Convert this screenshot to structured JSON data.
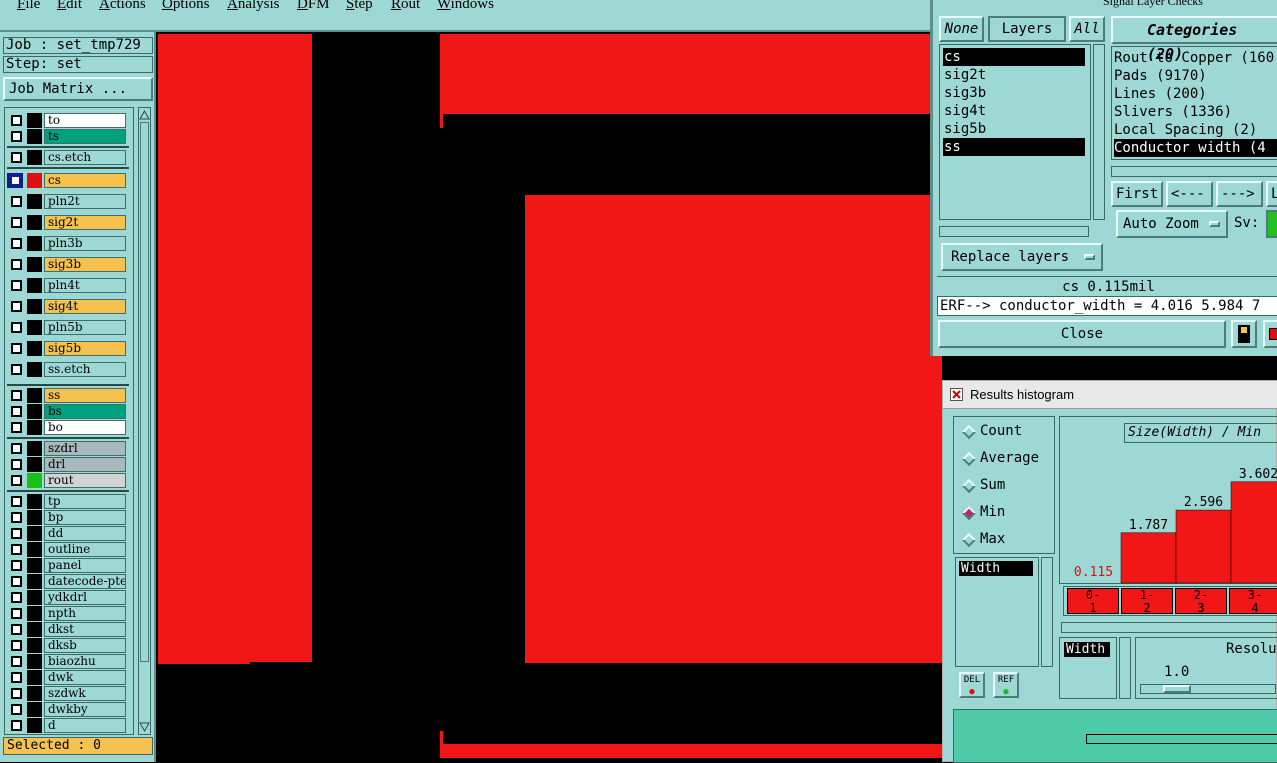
{
  "menu": [
    "File",
    "Edit",
    "Actions",
    "Options",
    "Analysis",
    "DFM",
    "Step",
    "Rout",
    "Windows"
  ],
  "job": {
    "label": "Job : set_tmp729",
    "step": "Step: set",
    "matrix_button": "Job Matrix ..."
  },
  "layers": [
    {
      "name": "to",
      "bg": "#ffffff",
      "swatch": "#000000"
    },
    {
      "name": "ts",
      "bg": "#00a17e",
      "swatch": "#000000"
    },
    {
      "name": "cs.etch",
      "bg": "#9ed8d4",
      "swatch": "#000000"
    },
    {
      "name": "cs",
      "bg": "#f5c14f",
      "swatch": "#e01010",
      "active": true
    },
    {
      "name": "pln2t",
      "bg": "#9ed8d4",
      "swatch": "#000000"
    },
    {
      "name": "sig2t",
      "bg": "#f5c14f",
      "swatch": "#000000"
    },
    {
      "name": "pln3b",
      "bg": "#9ed8d4",
      "swatch": "#000000"
    },
    {
      "name": "sig3b",
      "bg": "#f5c14f",
      "swatch": "#000000"
    },
    {
      "name": "pln4t",
      "bg": "#9ed8d4",
      "swatch": "#000000"
    },
    {
      "name": "sig4t",
      "bg": "#f5c14f",
      "swatch": "#000000"
    },
    {
      "name": "pln5b",
      "bg": "#9ed8d4",
      "swatch": "#000000"
    },
    {
      "name": "sig5b",
      "bg": "#f5c14f",
      "swatch": "#000000"
    },
    {
      "name": "ss.etch",
      "bg": "#9ed8d4",
      "swatch": "#000000"
    },
    {
      "name": "ss",
      "bg": "#f5c14f",
      "swatch": "#000000"
    },
    {
      "name": "bs",
      "bg": "#00a17e",
      "swatch": "#000000"
    },
    {
      "name": "bo",
      "bg": "#ffffff",
      "swatch": "#000000"
    },
    {
      "name": "szdrl",
      "bg": "#a9b8bd",
      "swatch": "#000000"
    },
    {
      "name": "drl",
      "bg": "#a9b8bd",
      "swatch": "#000000"
    },
    {
      "name": "rout",
      "bg": "#d3d3d3",
      "swatch": "#18c018"
    },
    {
      "name": "tp",
      "bg": "#9ed8d4",
      "swatch": "#000000"
    },
    {
      "name": "bp",
      "bg": "#9ed8d4",
      "swatch": "#000000"
    },
    {
      "name": "dd",
      "bg": "#9ed8d4",
      "swatch": "#000000"
    },
    {
      "name": "outline",
      "bg": "#9ed8d4",
      "swatch": "#000000"
    },
    {
      "name": "panel",
      "bg": "#9ed8d4",
      "swatch": "#000000"
    },
    {
      "name": "datecode-pte",
      "bg": "#9ed8d4",
      "swatch": "#000000"
    },
    {
      "name": "ydkdrl",
      "bg": "#9ed8d4",
      "swatch": "#000000"
    },
    {
      "name": "npth",
      "bg": "#9ed8d4",
      "swatch": "#000000"
    },
    {
      "name": "dkst",
      "bg": "#9ed8d4",
      "swatch": "#000000"
    },
    {
      "name": "dksb",
      "bg": "#9ed8d4",
      "swatch": "#000000"
    },
    {
      "name": "biaozhu",
      "bg": "#9ed8d4",
      "swatch": "#000000"
    },
    {
      "name": "dwk",
      "bg": "#9ed8d4",
      "swatch": "#000000"
    },
    {
      "name": "szdwk",
      "bg": "#9ed8d4",
      "swatch": "#000000"
    },
    {
      "name": "dwkby",
      "bg": "#9ed8d4",
      "swatch": "#000000"
    },
    {
      "name": "d",
      "bg": "#9ed8d4",
      "swatch": "#000000"
    }
  ],
  "selected": "Selected : 0",
  "slc": {
    "title": "Signal Layer Checks",
    "tabs": [
      "None",
      "Layers",
      "All"
    ],
    "layer_list": [
      "cs",
      "sig2t",
      "sig3b",
      "sig4t",
      "sig5b",
      "ss"
    ],
    "categories_title": "Categories (20)",
    "categories": [
      "Rout to Copper (160",
      "Pads (9170)",
      "Lines (200)",
      "Slivers (1336)",
      "Local Spacing (2)",
      "Conductor width (4"
    ],
    "nav": [
      "First",
      "<---",
      "--->",
      "La"
    ],
    "auto_zoom": "Auto Zoom",
    "sv": "Sv:",
    "replace": "Replace layers",
    "status": "cs 0.115mil",
    "erf": "ERF--> conductor_width = 4.016 5.984 7",
    "close": "Close",
    "colors": {
      "active_tab": "#9ed8d4",
      "sel": "#000000"
    }
  },
  "hist": {
    "title": "Results histogram",
    "modes": [
      "Count",
      "Average",
      "Sum",
      "Min",
      "Max"
    ],
    "selected_mode": "Min",
    "field": "Width",
    "field2": "Width",
    "chart_title": "Size(Width) / Min",
    "bar_values": [
      "0.115",
      "1.787",
      "2.596",
      "3.602"
    ],
    "bar_labels": [
      "0-\n1",
      "1-\n2",
      "2-\n3",
      "3-\n4"
    ],
    "resolution_label": "Resolu",
    "resolution_value": "1.0",
    "del": "DEL",
    "ref": "REF"
  },
  "chart_data": {
    "type": "bar",
    "title": "Size(Width) / Min",
    "categories": [
      "0-1",
      "1-2",
      "2-3",
      "3-4"
    ],
    "values": [
      0.115,
      1.787,
      2.596,
      3.602
    ]
  }
}
